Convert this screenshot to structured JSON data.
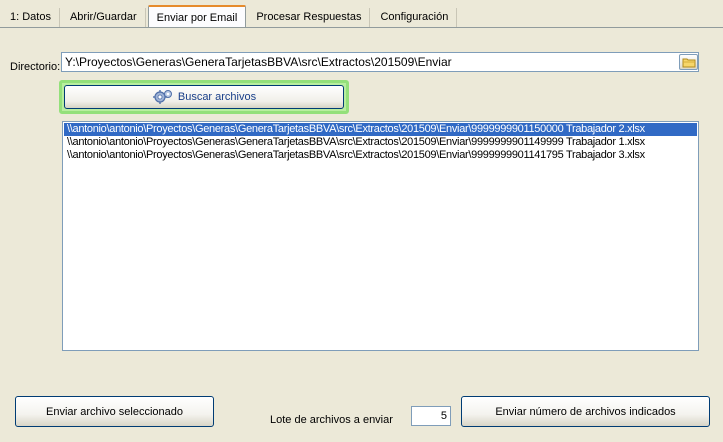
{
  "tabs": [
    {
      "label": "1: Datos"
    },
    {
      "label": "Abrir/Guardar"
    },
    {
      "label": "Enviar por Email"
    },
    {
      "label": "Procesar Respuestas"
    },
    {
      "label": "Configuración"
    }
  ],
  "active_tab": "Enviar por Email",
  "directory": {
    "label": "Directorio:",
    "value": "Y:\\Proyectos\\Generas\\GeneraTarjetasBBVA\\src\\Extractos\\201509\\Enviar",
    "browse_icon": "folder-icon"
  },
  "search_button": {
    "label": "Buscar archivos",
    "icon": "gears-icon"
  },
  "files": [
    {
      "path": "\\\\antonio\\antonio\\Proyectos\\Generas\\GeneraTarjetasBBVA\\src\\Extractos\\201509\\Enviar\\9999999901150000 Trabajador 2.xlsx",
      "selected": true
    },
    {
      "path": "\\\\antonio\\antonio\\Proyectos\\Generas\\GeneraTarjetasBBVA\\src\\Extractos\\201509\\Enviar\\9999999901149999 Trabajador 1.xlsx",
      "selected": false
    },
    {
      "path": "\\\\antonio\\antonio\\Proyectos\\Generas\\GeneraTarjetasBBVA\\src\\Extractos\\201509\\Enviar\\9999999901141795 Trabajador 3.xlsx",
      "selected": false
    }
  ],
  "bottom": {
    "send_selected_label": "Enviar archivo seleccionado",
    "batch_label": "Lote de archivos a enviar",
    "batch_value": "5",
    "send_count_label": "Enviar número de archivos indicados"
  },
  "colors": {
    "selection": "#316ac5",
    "focus_highlight": "#93e07a",
    "active_tab_accent": "#e68b2c"
  }
}
